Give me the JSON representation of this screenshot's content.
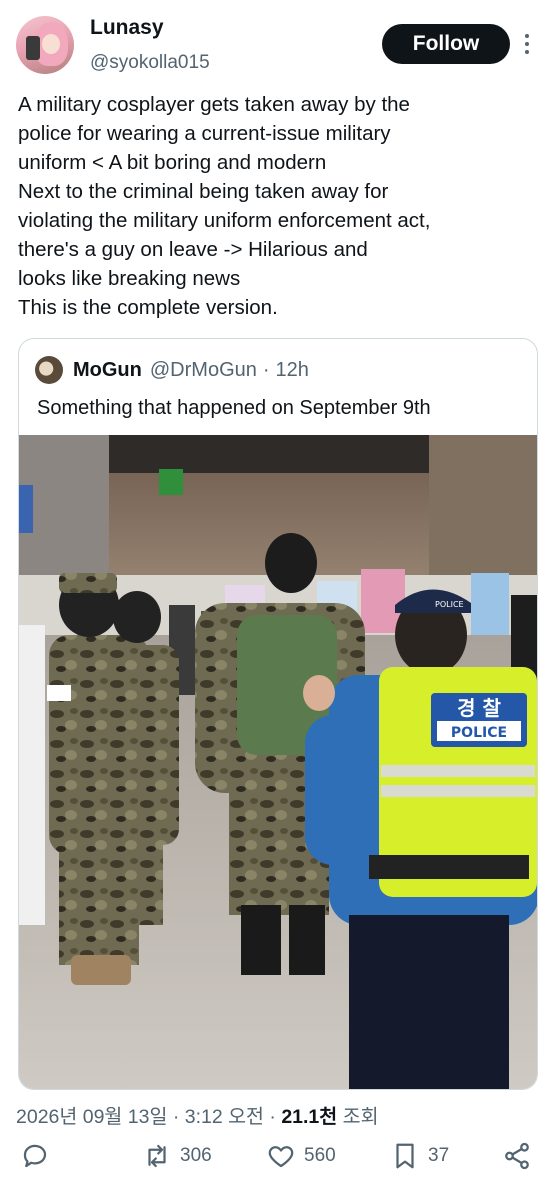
{
  "author": {
    "display_name": "Lunasy",
    "handle": "@syokolla015",
    "follow_label": "Follow"
  },
  "tweet": {
    "lines": [
      "A military cosplayer gets taken away by the",
      "police for wearing a current-issue military",
      "uniform < A bit boring and modern",
      "Next to the criminal being taken away for",
      "violating the military uniform enforcement act,",
      "there's a guy on leave -> Hilarious and",
      "looks like breaking news",
      "This is the complete version."
    ]
  },
  "quote": {
    "name": "MoGun",
    "handle": "@DrMoGun",
    "separator": "·",
    "time": "12h",
    "text": "Something that happened on September 9th",
    "photo": {
      "exit_sign": "",
      "vest_line1": "경 찰",
      "vest_line2": "POLICE",
      "cap_label": "POLICE"
    }
  },
  "meta": {
    "date": "2026년 09월 13일 · 3:12 오전 · ",
    "views": "21.1천",
    "views_label": " 조회"
  },
  "actions": {
    "retweets": "306",
    "likes": "560",
    "bookmarks": "37"
  },
  "icons": [
    "more-vertical-icon",
    "reply-icon",
    "retweet-icon",
    "like-icon",
    "bookmark-icon",
    "share-icon"
  ],
  "colors": {
    "text": "#0f1419",
    "secondary": "#536471",
    "border": "#cfd9de",
    "follow_bg": "#0f1419",
    "vest": "#d7ee2a",
    "police_blue": "#2f6fb8"
  }
}
